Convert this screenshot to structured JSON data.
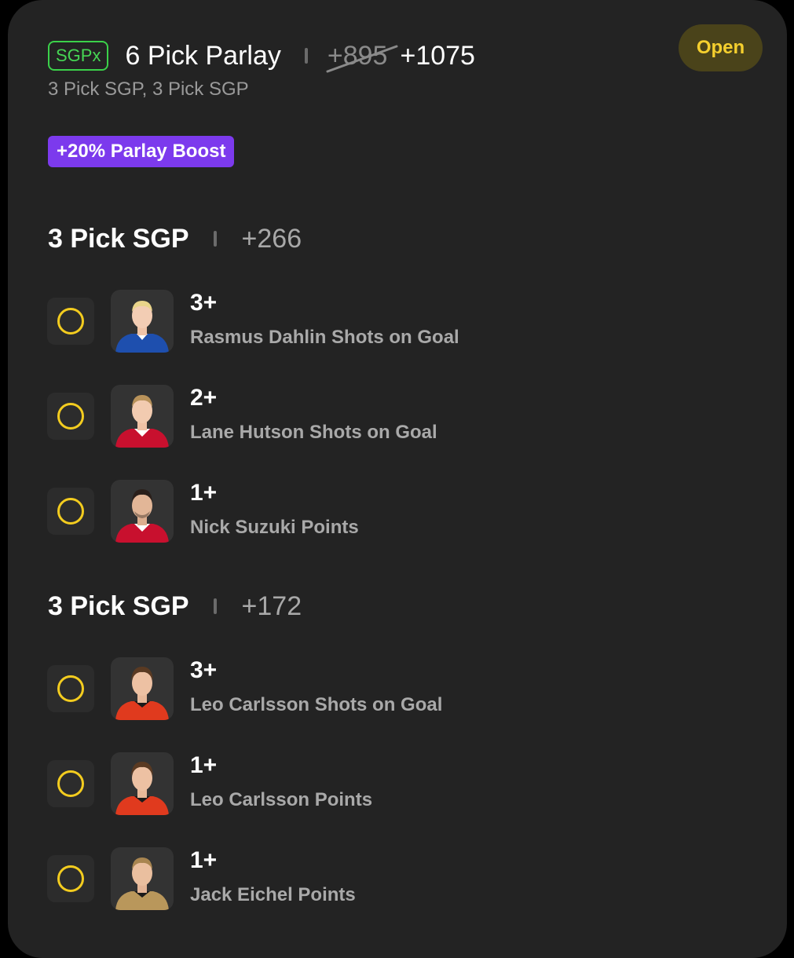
{
  "header": {
    "badge": "SGPx",
    "title": "6 Pick Parlay",
    "odds_original": "+895",
    "odds_boosted": "+1075",
    "subtitle": "3 Pick SGP, 3 Pick SGP",
    "status": "Open",
    "boost_label": "+20% Parlay Boost"
  },
  "colors": {
    "card_bg": "#232323",
    "sgpx_green": "#46d654",
    "open_yellow": "#f5cf2e",
    "boost_purple": "#7c3aed",
    "pick_circle": "#f3cc1f"
  },
  "sections": [
    {
      "title": "3 Pick SGP",
      "odds": "+266",
      "picks": [
        {
          "line": "3+",
          "desc": "Rasmus Dahlin Shots on Goal",
          "jersey": "blue"
        },
        {
          "line": "2+",
          "desc": "Lane Hutson Shots on Goal",
          "jersey": "red"
        },
        {
          "line": "1+",
          "desc": "Nick Suzuki Points",
          "jersey": "red"
        }
      ]
    },
    {
      "title": "3 Pick SGP",
      "odds": "+172",
      "picks": [
        {
          "line": "3+",
          "desc": "Leo Carlsson Shots on Goal",
          "jersey": "orange"
        },
        {
          "line": "1+",
          "desc": "Leo Carlsson Points",
          "jersey": "orange"
        },
        {
          "line": "1+",
          "desc": "Jack Eichel Points",
          "jersey": "gold"
        }
      ]
    }
  ]
}
